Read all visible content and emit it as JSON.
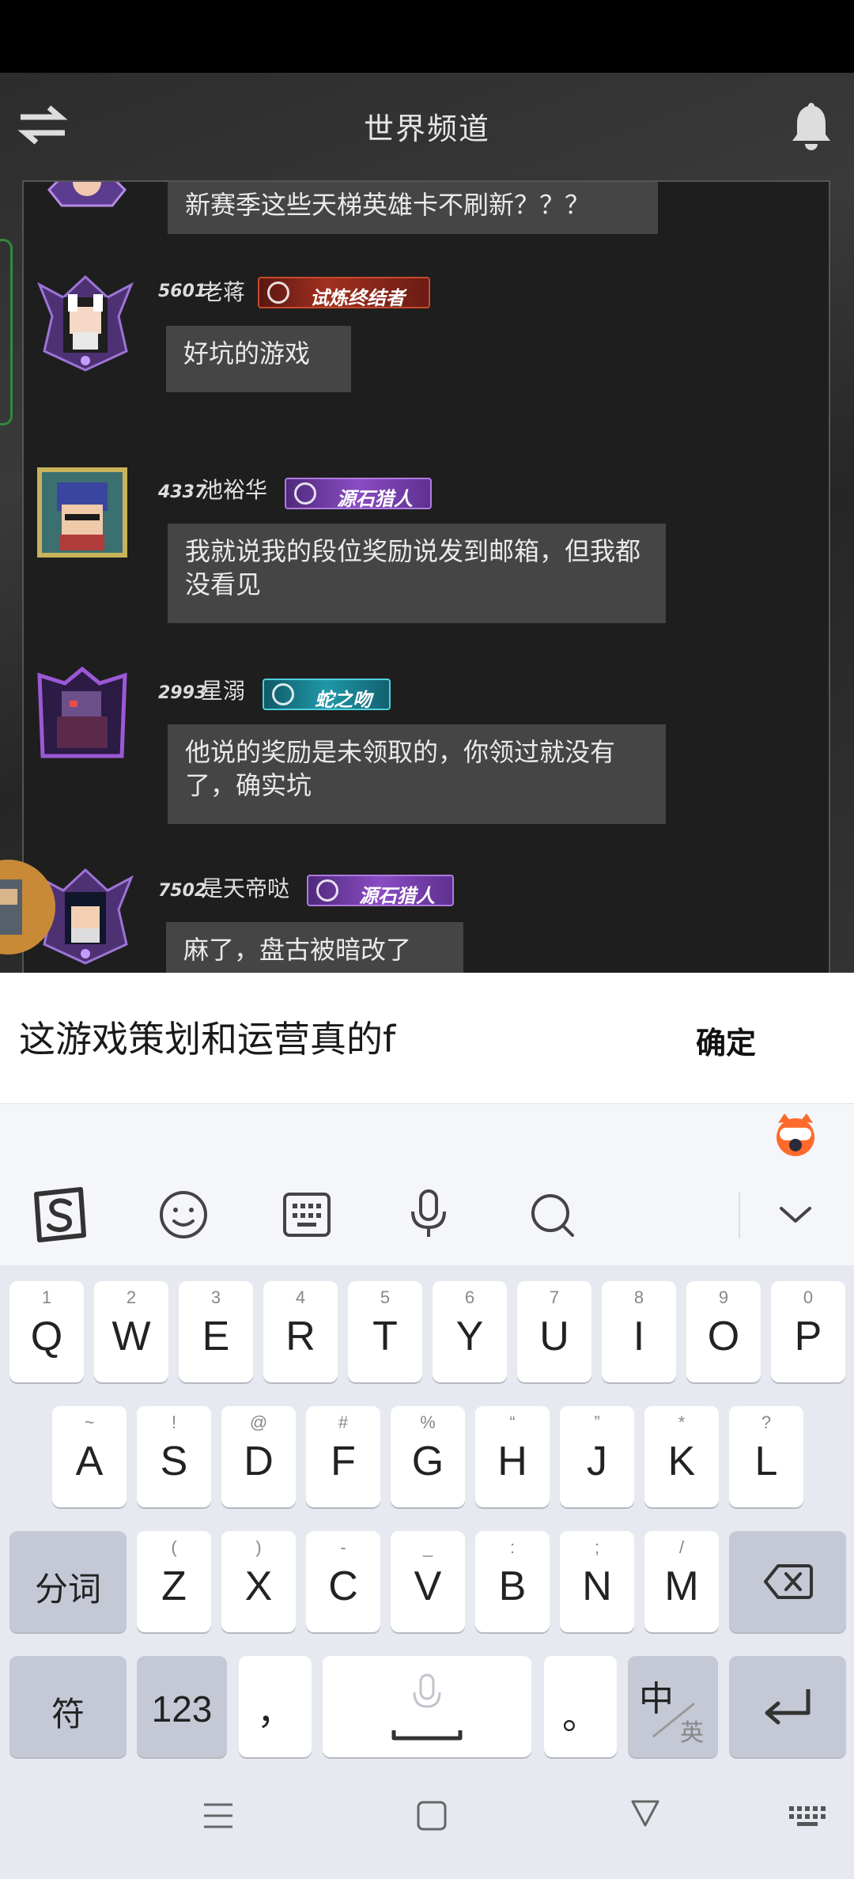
{
  "game": {
    "title": "世界频道",
    "icons": {
      "swap": "swap-arrows-icon",
      "bell": "bell-icon"
    }
  },
  "messages": [
    {
      "text": "新赛季这些天梯英雄卡不刷新？？？"
    },
    {
      "level": "5601",
      "name": "老蒋",
      "badge": "试炼终结者",
      "text": "好坑的游戏"
    },
    {
      "level": "4337",
      "name": "池裕华",
      "badge": "源石猎人",
      "text": "我就说我的段位奖励说发到邮箱，但我都没看见"
    },
    {
      "level": "2993",
      "name": "星溺",
      "badge": "蛇之吻",
      "text": "他说的奖励是未领取的，你领过就没有了，确实坑"
    },
    {
      "level": "7502",
      "name": "是天帝哒",
      "badge": "源石猎人",
      "text": "麻了，盘古被暗改了"
    }
  ],
  "input": {
    "value": "这游戏策划和运营真的f",
    "confirm_label": "确定"
  },
  "keyboard": {
    "toolbar": [
      "sogou-logo-icon",
      "emoji-icon",
      "keyboard-icon",
      "microphone-icon",
      "search-icon",
      "chevron-down-icon"
    ],
    "row1": [
      {
        "k": "Q",
        "s": "1"
      },
      {
        "k": "W",
        "s": "2"
      },
      {
        "k": "E",
        "s": "3"
      },
      {
        "k": "R",
        "s": "4"
      },
      {
        "k": "T",
        "s": "5"
      },
      {
        "k": "Y",
        "s": "6"
      },
      {
        "k": "U",
        "s": "7"
      },
      {
        "k": "I",
        "s": "8"
      },
      {
        "k": "O",
        "s": "9"
      },
      {
        "k": "P",
        "s": "0"
      }
    ],
    "row2": [
      {
        "k": "A",
        "s": "~"
      },
      {
        "k": "S",
        "s": "!"
      },
      {
        "k": "D",
        "s": "@"
      },
      {
        "k": "F",
        "s": "#"
      },
      {
        "k": "G",
        "s": "%"
      },
      {
        "k": "H",
        "s": "“"
      },
      {
        "k": "J",
        "s": "”"
      },
      {
        "k": "K",
        "s": "*"
      },
      {
        "k": "L",
        "s": "?"
      }
    ],
    "row3": [
      {
        "k": "Z",
        "s": "("
      },
      {
        "k": "X",
        "s": ")"
      },
      {
        "k": "C",
        "s": "-"
      },
      {
        "k": "V",
        "s": "_"
      },
      {
        "k": "B",
        "s": ":"
      },
      {
        "k": "N",
        "s": ";"
      },
      {
        "k": "M",
        "s": "/"
      }
    ],
    "fenci": "分词",
    "fu": "符",
    "num": "123",
    "comma": "，",
    "period": "。",
    "zh": "中",
    "en": "英"
  }
}
